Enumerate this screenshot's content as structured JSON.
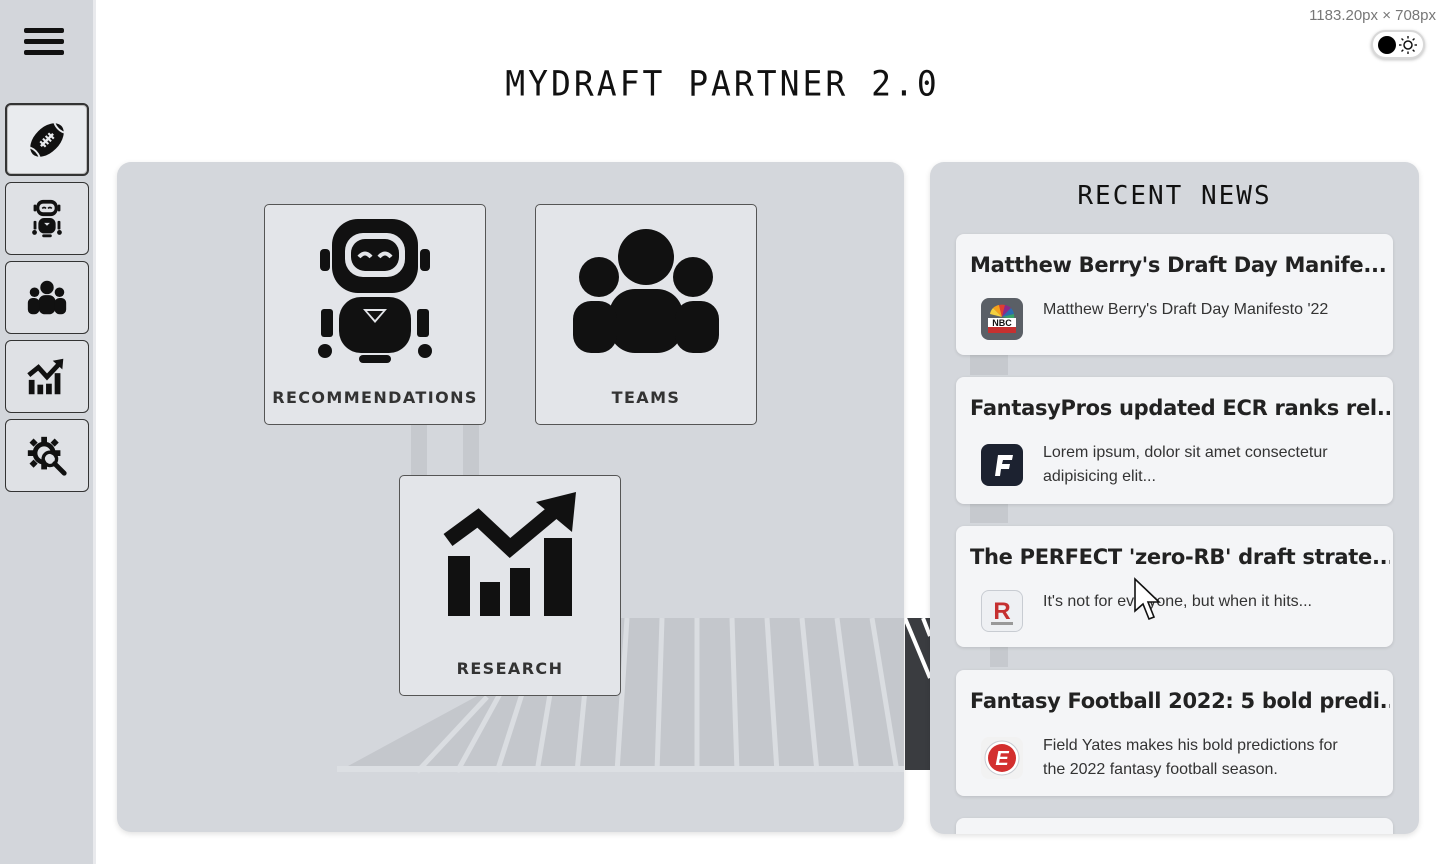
{
  "app": {
    "title": "MYDRAFT PARTNER 2.0",
    "size_readout": "1183.20px × 708px",
    "theme_toggle": {
      "state": "light"
    }
  },
  "sidebar": {
    "menu_icon": "hamburger-menu-icon",
    "items": [
      {
        "id": "home",
        "icon": "football-icon",
        "active": true
      },
      {
        "id": "recommendations",
        "icon": "robot-icon",
        "active": false
      },
      {
        "id": "teams",
        "icon": "users-group-icon",
        "active": false
      },
      {
        "id": "research",
        "icon": "chart-trend-icon",
        "active": false
      },
      {
        "id": "settings",
        "icon": "gear-search-icon",
        "active": false
      }
    ]
  },
  "main": {
    "tiles": [
      {
        "id": "recommendations",
        "label": "RECOMMENDATIONS",
        "icon": "robot-icon"
      },
      {
        "id": "teams",
        "label": "TEAMS",
        "icon": "users-group-icon"
      },
      {
        "id": "research",
        "label": "RESEARCH",
        "icon": "chart-trend-icon"
      }
    ]
  },
  "news": {
    "title": "RECENT NEWS",
    "items": [
      {
        "headline": "Matthew Berry's Draft Day Manife...",
        "summary": "Matthew Berry's Draft Day Manifesto '22",
        "source_logo": "nbc-sports-logo"
      },
      {
        "headline": "FantasyPros updated ECR ranks rel...",
        "summary": "Lorem ipsum, dolor sit amet consectetur adipisicing elit...",
        "source_logo": "fantasypros-logo"
      },
      {
        "headline": "The PERFECT 'zero-RB' draft strate...",
        "summary": "It's not for everyone, but when it hits...",
        "source_logo": "rotoworld-logo"
      },
      {
        "headline": "Fantasy Football 2022: 5 bold predi...",
        "summary": "Field Yates makes his bold predictions for the 2022 fantasy football season.",
        "source_logo": "espn-logo"
      }
    ]
  },
  "colors": {
    "panel": "#d4d7dc",
    "sidebar": "#d3d6db",
    "card": "#f4f5f7",
    "tile": "#e3e5e9"
  }
}
